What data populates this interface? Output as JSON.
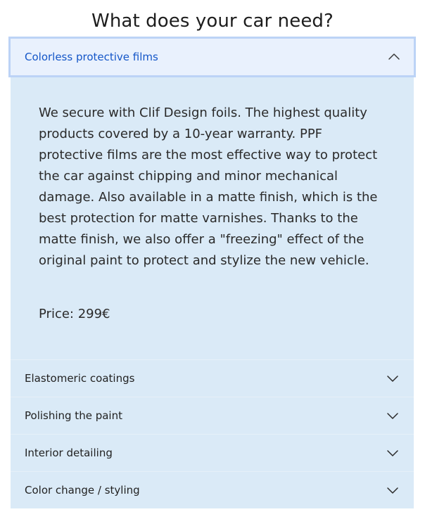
{
  "page": {
    "title": "What does your car need?"
  },
  "accordion": {
    "active": {
      "label": "Colorless protective films",
      "icon": "chevron-up-icon",
      "description": "We secure with Clif Design foils. The highest quality products covered by a 10-year warranty. PPF protective films are the most effective way to protect the car against chipping and minor mechanical damage. Also available in a matte finish, which is the best protection for matte varnishes. Thanks to the matte finish, we also offer a \"freezing\" effect of the original paint to protect and stylize the new vehicle.",
      "price": "Price: 299€"
    },
    "items": [
      {
        "label": "Elastomeric coatings",
        "icon": "chevron-down-icon"
      },
      {
        "label": "Polishing the paint",
        "icon": "chevron-down-icon"
      },
      {
        "label": "Interior detailing",
        "icon": "chevron-down-icon"
      },
      {
        "label": "Color change / styling",
        "icon": "chevron-down-icon"
      }
    ]
  },
  "colors": {
    "active_text": "#1456c8",
    "active_border": "#bcd3f6",
    "active_header_bg": "#e9f1fd",
    "panel_bg": "#daeaf7",
    "text": "#222222"
  }
}
